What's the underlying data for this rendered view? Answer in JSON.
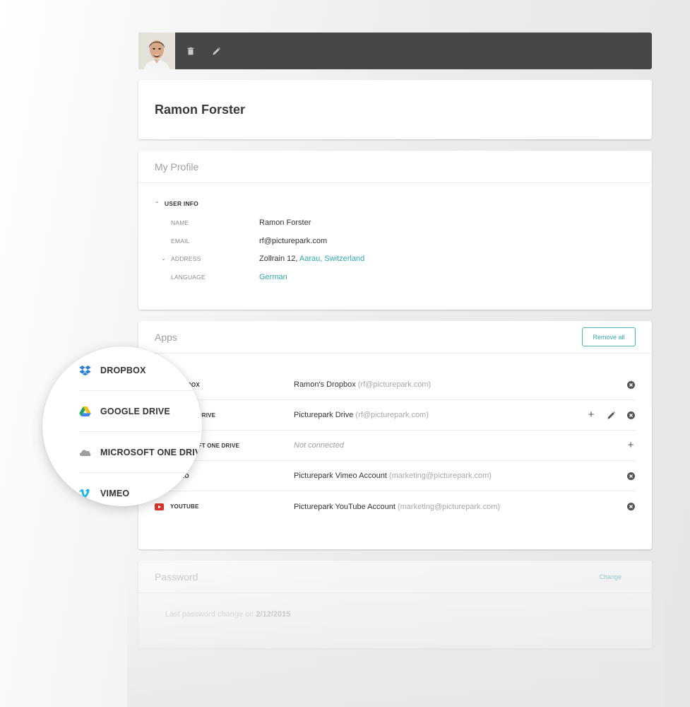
{
  "toolbar": {
    "icons": [
      "avatar",
      "trash-icon",
      "pencil-icon"
    ]
  },
  "header": {
    "name": "Ramon Forster"
  },
  "profile": {
    "title": "My Profile",
    "section_label": "USER INFO",
    "fields": {
      "name_label": "NAME",
      "name_value": "Ramon Forster",
      "email_label": "EMAIL",
      "email_value": "rf@picturepark.com",
      "address_label": "ADDRESS",
      "address_street": "Zollrain 12, ",
      "address_city": "Aarau, Switzerland",
      "language_label": "LANGUAGE",
      "language_value": "German"
    }
  },
  "apps": {
    "title": "Apps",
    "remove_all_label": "Remove all",
    "rows": [
      {
        "name": "DROPBOX",
        "account": "Ramon's Dropbox ",
        "email": "(rf@picturepark.com)"
      },
      {
        "name": "GOOGLE DRIVE",
        "account": "Picturepark Drive ",
        "email": "(rf@picturepark.com)"
      },
      {
        "name": "MICROSOFT ONE DRIVE",
        "account": "Not connected",
        "email": ""
      },
      {
        "name": "VIMEO",
        "account": "Picturepark Vimeo Account ",
        "email": "(marketing@picturepark.com)"
      },
      {
        "name": "YOUTUBE",
        "account": "Picturepark YouTube Account ",
        "email": "(marketing@picturepark.com)"
      }
    ]
  },
  "password": {
    "title": "Password",
    "change_label": "Change",
    "note_prefix": "Last password change on ",
    "note_date": "2/12/2015",
    "note_suffix": "."
  },
  "magnifier": {
    "items": [
      "DROPBOX",
      "GOOGLE DRIVE",
      "MICROSOFT ONE DRIVE",
      "VIMEO"
    ]
  },
  "colors": {
    "toolbar": "#474747",
    "accent": "#33a9b0",
    "dropbox": "#2f7fd0",
    "youtube": "#d7352b",
    "vimeo": "#1ab7ea",
    "onedrive": "#9e9e9e"
  }
}
